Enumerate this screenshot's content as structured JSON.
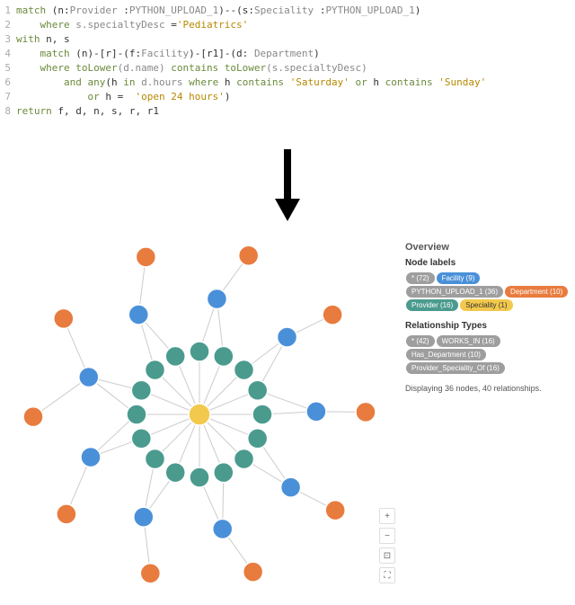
{
  "code": {
    "lines": [
      {
        "n": "1",
        "tokens": [
          {
            "t": "match ",
            "c": "kw"
          },
          {
            "t": "(n:",
            "c": "pun"
          },
          {
            "t": "Provider ",
            "c": "label"
          },
          {
            "t": ":",
            "c": "pun"
          },
          {
            "t": "PYTHON_UPLOAD_1",
            "c": "label"
          },
          {
            "t": ")--(s:",
            "c": "pun"
          },
          {
            "t": "Speciality ",
            "c": "label"
          },
          {
            "t": ":",
            "c": "pun"
          },
          {
            "t": "PYTHON_UPLOAD_1",
            "c": "label"
          },
          {
            "t": ")",
            "c": "pun"
          }
        ]
      },
      {
        "n": "2",
        "tokens": [
          {
            "t": "    where ",
            "c": "kw"
          },
          {
            "t": "s.specialtyDesc ",
            "c": "dot"
          },
          {
            "t": "=",
            "c": "op"
          },
          {
            "t": "'Pediatrics'",
            "c": "str"
          }
        ]
      },
      {
        "n": "3",
        "tokens": [
          {
            "t": "with ",
            "c": "kw"
          },
          {
            "t": "n, s",
            "c": "var"
          }
        ]
      },
      {
        "n": "4",
        "tokens": [
          {
            "t": "    match ",
            "c": "kw"
          },
          {
            "t": "(n)-[r]-(f:",
            "c": "pun"
          },
          {
            "t": "Facility",
            "c": "label"
          },
          {
            "t": ")-[r1]-(d: ",
            "c": "pun"
          },
          {
            "t": "Department",
            "c": "label"
          },
          {
            "t": ")",
            "c": "pun"
          }
        ]
      },
      {
        "n": "5",
        "tokens": [
          {
            "t": "    where ",
            "c": "kw"
          },
          {
            "t": "toLower",
            "c": "kw"
          },
          {
            "t": "(d.name) ",
            "c": "dot"
          },
          {
            "t": "contains ",
            "c": "kw"
          },
          {
            "t": "toLower",
            "c": "kw"
          },
          {
            "t": "(s.specialtyDesc)",
            "c": "dot"
          }
        ]
      },
      {
        "n": "6",
        "tokens": [
          {
            "t": "        and any",
            "c": "kw"
          },
          {
            "t": "(h ",
            "c": "pun"
          },
          {
            "t": "in ",
            "c": "kw"
          },
          {
            "t": "d.hours ",
            "c": "dot"
          },
          {
            "t": "where ",
            "c": "kw"
          },
          {
            "t": "h ",
            "c": "var"
          },
          {
            "t": "contains ",
            "c": "kw"
          },
          {
            "t": "'Saturday' ",
            "c": "str"
          },
          {
            "t": "or ",
            "c": "kw"
          },
          {
            "t": "h ",
            "c": "var"
          },
          {
            "t": "contains ",
            "c": "kw"
          },
          {
            "t": "'Sunday'",
            "c": "str"
          }
        ]
      },
      {
        "n": "7",
        "tokens": [
          {
            "t": "            or ",
            "c": "kw"
          },
          {
            "t": "h ",
            "c": "var"
          },
          {
            "t": "=  ",
            "c": "op"
          },
          {
            "t": "'open 24 hours'",
            "c": "str"
          },
          {
            "t": ")",
            "c": "pun"
          }
        ]
      },
      {
        "n": "8",
        "tokens": [
          {
            "t": "return ",
            "c": "kw"
          },
          {
            "t": "f, d, n, s, r, r1",
            "c": "var"
          }
        ]
      }
    ]
  },
  "overview": {
    "title": "Overview",
    "nodeLabelsTitle": "Node labels",
    "relTypesTitle": "Relationship Types",
    "nodeLabels": [
      {
        "text": "* (72)",
        "cls": "gray"
      },
      {
        "text": "Facility (9)",
        "cls": "blue"
      },
      {
        "text": "PYTHON_UPLOAD_1 (36)",
        "cls": "gray"
      },
      {
        "text": "Department (10)",
        "cls": "orange"
      },
      {
        "text": "Provider (16)",
        "cls": "teal"
      },
      {
        "text": "Speciality (1)",
        "cls": "yellow"
      }
    ],
    "relTypes": [
      {
        "text": "* (42)",
        "cls": "gray"
      },
      {
        "text": "WORKS_IN (16)",
        "cls": "gray"
      },
      {
        "text": "Has_Department (10)",
        "cls": "gray"
      },
      {
        "text": "Provider_Speciality_Of (16)",
        "cls": "gray"
      }
    ],
    "stats": "Displaying 36 nodes, 40 relationships."
  },
  "zoom": {
    "in": "+",
    "out": "−",
    "fit": "⊡",
    "full": "⛶"
  },
  "colors": {
    "speciality": "#f2c94c",
    "provider": "#4a9b8e",
    "facility": "#4a90d9",
    "department": "#e87b3e"
  },
  "graph_data": {
    "description": "Radial hub-and-spoke graph",
    "center": {
      "type": "Speciality",
      "count": 1
    },
    "ring1": {
      "type": "Provider",
      "count": 16
    },
    "ring2": {
      "type": "Facility",
      "count": 9
    },
    "ring3": {
      "type": "Department",
      "count": 10
    },
    "edges": {
      "total": 40
    }
  }
}
